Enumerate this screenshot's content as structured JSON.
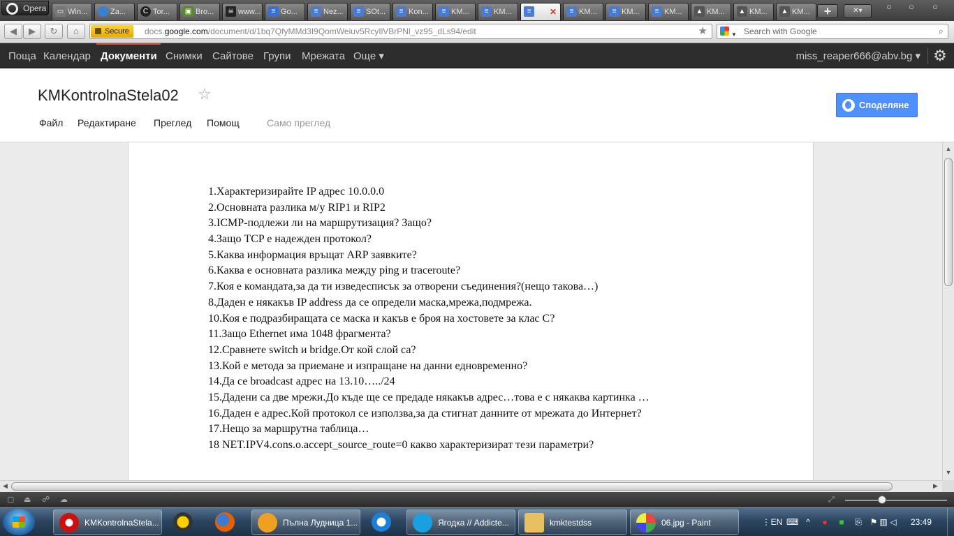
{
  "browser": {
    "menu_label": "Opera",
    "tabs": [
      {
        "label": "Win...",
        "icon": "window-icon"
      },
      {
        "label": "Za...",
        "icon": "circle-icon"
      },
      {
        "label": "Tor...",
        "icon": "torrent-icon"
      },
      {
        "label": "Bro...",
        "icon": "image-icon"
      },
      {
        "label": "www...",
        "icon": "pirate-icon"
      },
      {
        "label": "Go...",
        "icon": "google-doc-icon"
      },
      {
        "label": "Nez...",
        "icon": "doc-icon"
      },
      {
        "label": "SOt...",
        "icon": "doc-icon"
      },
      {
        "label": "Kon...",
        "icon": "doc-icon"
      },
      {
        "label": "KM...",
        "icon": "doc-icon"
      },
      {
        "label": "KM...",
        "icon": "doc-icon"
      },
      {
        "label": "",
        "icon": "doc-icon",
        "close": "✕"
      },
      {
        "label": "KM...",
        "icon": "doc-icon"
      },
      {
        "label": "KM...",
        "icon": "doc-icon"
      },
      {
        "label": "KM...",
        "icon": "doc-icon"
      },
      {
        "label": "KM...",
        "icon": "picture-icon"
      },
      {
        "label": "KM...",
        "icon": "picture-icon"
      },
      {
        "label": "KM...",
        "icon": "picture-icon"
      }
    ],
    "add_tab": "+",
    "closed_tabs": "✕▾",
    "secure_label": "Secure",
    "url_prefix": "docs.",
    "url_host": "google.com",
    "url_path": "/document/d/1bq7QfyMMd3I9QomWeiuv5RcyIlVBrPNl_vz95_dLs94/edit",
    "search_placeholder": "Search with Google"
  },
  "gbar": {
    "items": [
      "Поща",
      "Календар",
      "Документи",
      "Снимки",
      "Сайтове",
      "Групи",
      "Мрежата",
      "Още ▾"
    ],
    "selected": "Документи",
    "user": "miss_reaper666@abv.bg ▾"
  },
  "docs": {
    "title": "KMKontrolnaStela02",
    "share_label": "Споделяне",
    "menu": [
      "Файл",
      "Редактиране",
      "Преглед",
      "Помощ"
    ],
    "view_only": "Само преглед",
    "questions": [
      "1.Характеризирайте IP адрес 10.0.0.0",
      "2.Основната разлика м/у RIP1 и RIP2",
      "3.ICMP-подлежи ли на маршрутизация? Защо?",
      "4.Защо TCP е надежден протокол?",
      "5.Каква информация връщат ARP заявките?",
      "6.Каква е основната разлика между ping и traceroute?",
      "7.Коя е командата,за да ти изведесписък за отворени съединения?(нещо такова…)",
      "8.Даден е някакъв IP address да се определи маска,мрежа,подмрежа.",
      "10.Коя е подразбиращата се маска и какъв е броя на хостовете за клас C?",
      "11.Защо Ethernet има 1048 фрагмента?",
      "12.Сравнете switch и bridge.От кой слой са?",
      "13.Кой е метода за приемане и изпращане на данни едновременно?",
      "14.Да се broadcast адрес на 13.10…../24",
      "15.Дадени са две мрежи.До къде ще се предаде някакъв адрес…това е с някаква картинка …",
      "16.Даден е адрес.Кой протокол се използва,за да стигнат данните от мрежата до Интернет?",
      "17.Нещо за маршрутна таблица…",
      "18 NET.IPV4.cons.o.accept_source_route=0 какво характеризират тези параметри?"
    ]
  },
  "taskbar": {
    "tasks": [
      {
        "label": "KMKontrolnaStela...",
        "icon": "opera-icon",
        "color": "#cc1010"
      },
      {
        "label": "Пълна Лудница 1...",
        "icon": "chat-icon",
        "color": "#f0a020"
      },
      {
        "label": "Ягодка // Addicte...",
        "icon": "skype-icon",
        "color": "#1aa0e0"
      },
      {
        "label": "kmktestdss",
        "icon": "folder-icon",
        "color": "#e8c060"
      },
      {
        "label": "06.jpg - Paint",
        "icon": "paint-icon",
        "color": "#d9d9d9"
      }
    ],
    "language": "EN",
    "clock": "23:49"
  },
  "colors": {
    "gbar_bg": "#2d2d2d",
    "gbar_accent": "#dd4b39",
    "share_button": "#4d90fe",
    "taskbar": "#2c4560"
  }
}
